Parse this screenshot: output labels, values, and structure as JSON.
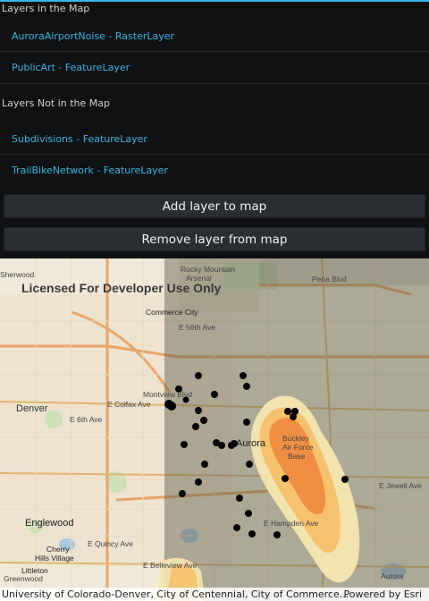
{
  "sections": {
    "in_map_header": "Layers in the Map",
    "not_in_map_header": "Layers Not in the Map"
  },
  "layers_in_map": [
    {
      "label": "AuroraAirportNoise - RasterLayer"
    },
    {
      "label": "PublicArt - FeatureLayer"
    }
  ],
  "layers_not_in_map": [
    {
      "label": "Subdivisions - FeatureLayer"
    },
    {
      "label": "TrailBikeNetwork - FeatureLayer"
    }
  ],
  "buttons": {
    "add_label": "Add layer to map",
    "remove_label": "Remove layer from map"
  },
  "map": {
    "watermark": "Licensed For Developer Use Only",
    "attribution": "University of Colorado-Denver, City of Centennial, City of Commerce...",
    "powered_by": "Powered by Esri",
    "labels": {
      "sherwood": "Sherwood",
      "rocky_mountain": "Rocky Mountain",
      "arsenal": "Arsenal",
      "penna_blvd": "Pena Blvd",
      "commerce_city": "Commerce City",
      "e_56th": "E 56th Ave",
      "denver": "Denver",
      "montview": "Montview Blvd",
      "e_colfax": "E Colfax Ave",
      "e_6th": "E 6th Ave",
      "aurora": "Aurora",
      "buckley": "Buckley",
      "air_force": "Air Force",
      "base": "Base",
      "e_jewell": "E Jewell Ave",
      "e_hampden": "E Hampden Ave",
      "e_quincy": "E Quincy Ave",
      "englewood": "Englewood",
      "cherry_hills": "Cherry",
      "cherry_hills_2": "Hills Village",
      "littleton": "Littleton",
      "e_belleview": "E Belleview Ave",
      "greenwood": "Greenwood",
      "aurora_res": "Aurora",
      "e_6th_east": "E 6th Ave"
    },
    "colors": {
      "noise_outer": "#f5e6b0",
      "noise_mid": "#f5c06a",
      "noise_inner": "#f08a3e",
      "overlay": "#5a5a4a",
      "point": "#000000"
    },
    "points_count_note": null
  }
}
